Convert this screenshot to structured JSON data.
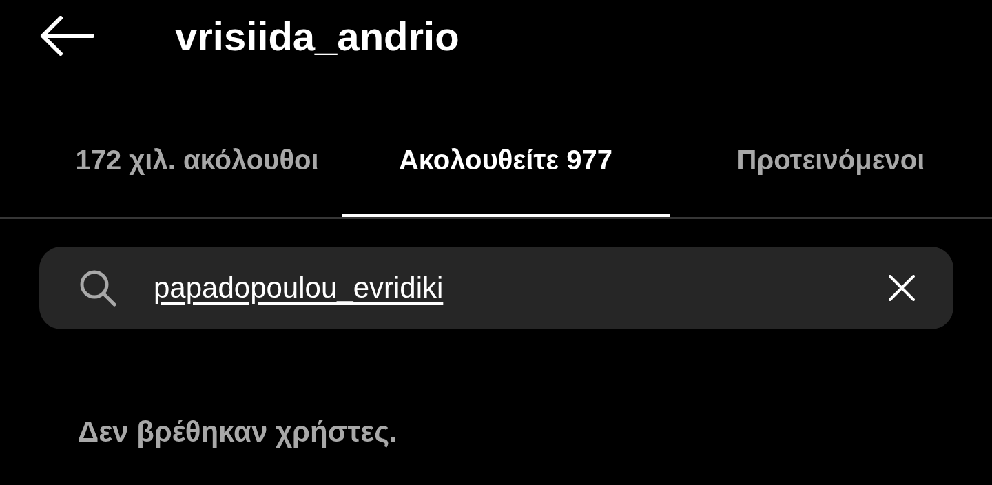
{
  "header": {
    "title": "vrisiida_andrio"
  },
  "tabs": [
    {
      "label": "172 χιλ. ακόλουθοι",
      "selected": false
    },
    {
      "label": "Ακολουθείτε 977",
      "selected": true
    },
    {
      "label": "Προτεινόμενοι",
      "selected": false
    }
  ],
  "search": {
    "value": "papadopoulou_evridiki"
  },
  "empty_message": "Δεν βρέθηκαν χρήστες."
}
